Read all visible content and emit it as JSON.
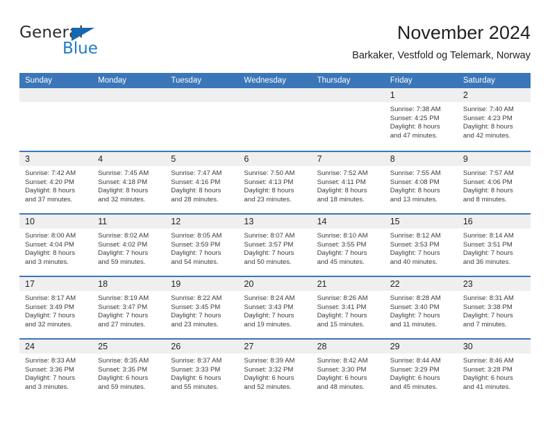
{
  "brand": {
    "name_part1": "General",
    "name_part2": "Blue",
    "triangle_icon": "triangle-icon",
    "color_dark": "#2b2b2b",
    "color_blue": "#1e7bc4"
  },
  "header": {
    "title": "November 2024",
    "subtitle": "Barkaker, Vestfold og Telemark, Norway"
  },
  "theme": {
    "header_blue": "#3a76b8",
    "day_band_gray": "#efefef",
    "text": "#231f20"
  },
  "weekdays": [
    "Sunday",
    "Monday",
    "Tuesday",
    "Wednesday",
    "Thursday",
    "Friday",
    "Saturday"
  ],
  "weeks": [
    [
      {
        "day": "",
        "empty": true
      },
      {
        "day": "",
        "empty": true
      },
      {
        "day": "",
        "empty": true
      },
      {
        "day": "",
        "empty": true
      },
      {
        "day": "",
        "empty": true
      },
      {
        "day": "1",
        "sunrise": "Sunrise: 7:38 AM",
        "sunset": "Sunset: 4:25 PM",
        "daylight1": "Daylight: 8 hours",
        "daylight2": "and 47 minutes."
      },
      {
        "day": "2",
        "sunrise": "Sunrise: 7:40 AM",
        "sunset": "Sunset: 4:23 PM",
        "daylight1": "Daylight: 8 hours",
        "daylight2": "and 42 minutes."
      }
    ],
    [
      {
        "day": "3",
        "sunrise": "Sunrise: 7:42 AM",
        "sunset": "Sunset: 4:20 PM",
        "daylight1": "Daylight: 8 hours",
        "daylight2": "and 37 minutes."
      },
      {
        "day": "4",
        "sunrise": "Sunrise: 7:45 AM",
        "sunset": "Sunset: 4:18 PM",
        "daylight1": "Daylight: 8 hours",
        "daylight2": "and 32 minutes."
      },
      {
        "day": "5",
        "sunrise": "Sunrise: 7:47 AM",
        "sunset": "Sunset: 4:16 PM",
        "daylight1": "Daylight: 8 hours",
        "daylight2": "and 28 minutes."
      },
      {
        "day": "6",
        "sunrise": "Sunrise: 7:50 AM",
        "sunset": "Sunset: 4:13 PM",
        "daylight1": "Daylight: 8 hours",
        "daylight2": "and 23 minutes."
      },
      {
        "day": "7",
        "sunrise": "Sunrise: 7:52 AM",
        "sunset": "Sunset: 4:11 PM",
        "daylight1": "Daylight: 8 hours",
        "daylight2": "and 18 minutes."
      },
      {
        "day": "8",
        "sunrise": "Sunrise: 7:55 AM",
        "sunset": "Sunset: 4:08 PM",
        "daylight1": "Daylight: 8 hours",
        "daylight2": "and 13 minutes."
      },
      {
        "day": "9",
        "sunrise": "Sunrise: 7:57 AM",
        "sunset": "Sunset: 4:06 PM",
        "daylight1": "Daylight: 8 hours",
        "daylight2": "and 8 minutes."
      }
    ],
    [
      {
        "day": "10",
        "sunrise": "Sunrise: 8:00 AM",
        "sunset": "Sunset: 4:04 PM",
        "daylight1": "Daylight: 8 hours",
        "daylight2": "and 3 minutes."
      },
      {
        "day": "11",
        "sunrise": "Sunrise: 8:02 AM",
        "sunset": "Sunset: 4:02 PM",
        "daylight1": "Daylight: 7 hours",
        "daylight2": "and 59 minutes."
      },
      {
        "day": "12",
        "sunrise": "Sunrise: 8:05 AM",
        "sunset": "Sunset: 3:59 PM",
        "daylight1": "Daylight: 7 hours",
        "daylight2": "and 54 minutes."
      },
      {
        "day": "13",
        "sunrise": "Sunrise: 8:07 AM",
        "sunset": "Sunset: 3:57 PM",
        "daylight1": "Daylight: 7 hours",
        "daylight2": "and 50 minutes."
      },
      {
        "day": "14",
        "sunrise": "Sunrise: 8:10 AM",
        "sunset": "Sunset: 3:55 PM",
        "daylight1": "Daylight: 7 hours",
        "daylight2": "and 45 minutes."
      },
      {
        "day": "15",
        "sunrise": "Sunrise: 8:12 AM",
        "sunset": "Sunset: 3:53 PM",
        "daylight1": "Daylight: 7 hours",
        "daylight2": "and 40 minutes."
      },
      {
        "day": "16",
        "sunrise": "Sunrise: 8:14 AM",
        "sunset": "Sunset: 3:51 PM",
        "daylight1": "Daylight: 7 hours",
        "daylight2": "and 36 minutes."
      }
    ],
    [
      {
        "day": "17",
        "sunrise": "Sunrise: 8:17 AM",
        "sunset": "Sunset: 3:49 PM",
        "daylight1": "Daylight: 7 hours",
        "daylight2": "and 32 minutes."
      },
      {
        "day": "18",
        "sunrise": "Sunrise: 8:19 AM",
        "sunset": "Sunset: 3:47 PM",
        "daylight1": "Daylight: 7 hours",
        "daylight2": "and 27 minutes."
      },
      {
        "day": "19",
        "sunrise": "Sunrise: 8:22 AM",
        "sunset": "Sunset: 3:45 PM",
        "daylight1": "Daylight: 7 hours",
        "daylight2": "and 23 minutes."
      },
      {
        "day": "20",
        "sunrise": "Sunrise: 8:24 AM",
        "sunset": "Sunset: 3:43 PM",
        "daylight1": "Daylight: 7 hours",
        "daylight2": "and 19 minutes."
      },
      {
        "day": "21",
        "sunrise": "Sunrise: 8:26 AM",
        "sunset": "Sunset: 3:41 PM",
        "daylight1": "Daylight: 7 hours",
        "daylight2": "and 15 minutes."
      },
      {
        "day": "22",
        "sunrise": "Sunrise: 8:28 AM",
        "sunset": "Sunset: 3:40 PM",
        "daylight1": "Daylight: 7 hours",
        "daylight2": "and 11 minutes."
      },
      {
        "day": "23",
        "sunrise": "Sunrise: 8:31 AM",
        "sunset": "Sunset: 3:38 PM",
        "daylight1": "Daylight: 7 hours",
        "daylight2": "and 7 minutes."
      }
    ],
    [
      {
        "day": "24",
        "sunrise": "Sunrise: 8:33 AM",
        "sunset": "Sunset: 3:36 PM",
        "daylight1": "Daylight: 7 hours",
        "daylight2": "and 3 minutes."
      },
      {
        "day": "25",
        "sunrise": "Sunrise: 8:35 AM",
        "sunset": "Sunset: 3:35 PM",
        "daylight1": "Daylight: 6 hours",
        "daylight2": "and 59 minutes."
      },
      {
        "day": "26",
        "sunrise": "Sunrise: 8:37 AM",
        "sunset": "Sunset: 3:33 PM",
        "daylight1": "Daylight: 6 hours",
        "daylight2": "and 55 minutes."
      },
      {
        "day": "27",
        "sunrise": "Sunrise: 8:39 AM",
        "sunset": "Sunset: 3:32 PM",
        "daylight1": "Daylight: 6 hours",
        "daylight2": "and 52 minutes."
      },
      {
        "day": "28",
        "sunrise": "Sunrise: 8:42 AM",
        "sunset": "Sunset: 3:30 PM",
        "daylight1": "Daylight: 6 hours",
        "daylight2": "and 48 minutes."
      },
      {
        "day": "29",
        "sunrise": "Sunrise: 8:44 AM",
        "sunset": "Sunset: 3:29 PM",
        "daylight1": "Daylight: 6 hours",
        "daylight2": "and 45 minutes."
      },
      {
        "day": "30",
        "sunrise": "Sunrise: 8:46 AM",
        "sunset": "Sunset: 3:28 PM",
        "daylight1": "Daylight: 6 hours",
        "daylight2": "and 41 minutes."
      }
    ]
  ]
}
